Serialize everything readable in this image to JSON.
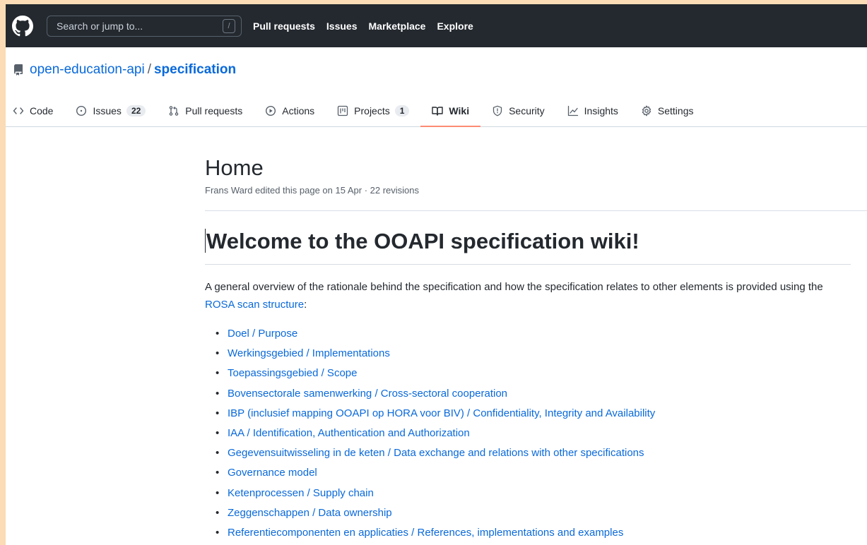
{
  "header": {
    "search_placeholder": "Search or jump to...",
    "search_key": "/",
    "nav": [
      "Pull requests",
      "Issues",
      "Marketplace",
      "Explore"
    ]
  },
  "repo": {
    "owner": "open-education-api",
    "separator": "/",
    "name": "specification"
  },
  "tabs": [
    {
      "label": "Code",
      "icon": "code-icon"
    },
    {
      "label": "Issues",
      "count": "22",
      "icon": "issue-icon"
    },
    {
      "label": "Pull requests",
      "icon": "pull-request-icon"
    },
    {
      "label": "Actions",
      "icon": "play-icon"
    },
    {
      "label": "Projects",
      "count": "1",
      "icon": "project-icon"
    },
    {
      "label": "Wiki",
      "icon": "book-icon",
      "active": true
    },
    {
      "label": "Security",
      "icon": "shield-icon"
    },
    {
      "label": "Insights",
      "icon": "graph-icon"
    },
    {
      "label": "Settings",
      "icon": "gear-icon"
    }
  ],
  "wiki": {
    "title": "Home",
    "meta": "Frans Ward edited this page on 15 Apr · 22 revisions",
    "heading": "Welcome to the OOAPI specification wiki!",
    "intro_before": "A general overview of the rationale behind the specification and how the specification relates to other elements is provided using the ",
    "intro_link": "ROSA scan structure",
    "intro_after": ":",
    "links": [
      "Doel / Purpose",
      "Werkingsgebied / Implementations",
      "Toepassingsgebied / Scope",
      "Bovensectorale samenwerking / Cross-sectoral cooperation",
      "IBP (inclusief mapping OOAPI op HORA voor BIV) / Confidentiality, Integrity and Availability",
      "IAA / Identification, Authentication and Authorization",
      "Gegevensuitwisseling in de keten / Data exchange and relations with other specifications",
      "Governance model",
      "Ketenprocessen / Supply chain",
      "Zeggenschappen / Data ownership",
      "Referentiecomponenten en applicaties / References, implementations and examples"
    ]
  },
  "colors": {
    "header_bg": "#24292f",
    "link": "#0969da",
    "active_tab_underline": "#fd8c73",
    "outer_bg": "#fbdcb6"
  }
}
